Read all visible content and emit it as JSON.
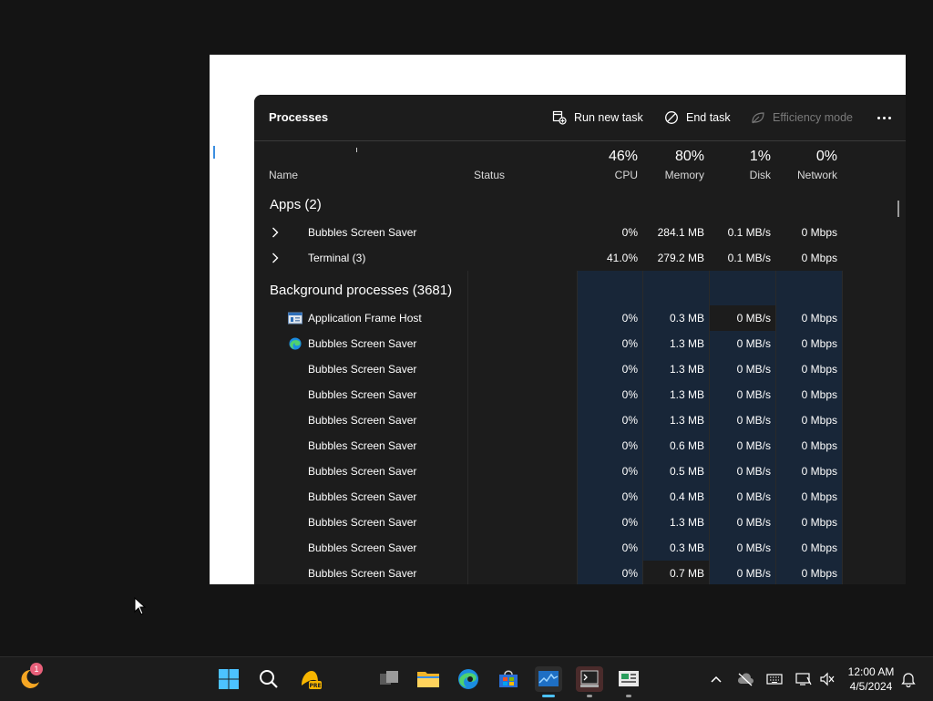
{
  "header": {
    "title": "Processes",
    "run_new_task": "Run new task",
    "end_task": "End task",
    "efficiency_mode": "Efficiency mode"
  },
  "columns": {
    "name": "Name",
    "status": "Status",
    "cpu": {
      "pct": "46%",
      "label": "CPU"
    },
    "memory": {
      "pct": "80%",
      "label": "Memory"
    },
    "disk": {
      "pct": "1%",
      "label": "Disk"
    },
    "network": {
      "pct": "0%",
      "label": "Network"
    }
  },
  "groups": {
    "apps": "Apps (2)",
    "background": "Background processes (3681)"
  },
  "apps": [
    {
      "name": "Bubbles Screen Saver",
      "cpu": "0%",
      "mem": "284.1 MB",
      "disk": "0.1 MB/s",
      "net": "0 Mbps"
    },
    {
      "name": "Terminal (3)",
      "cpu": "41.0%",
      "mem": "279.2 MB",
      "disk": "0.1 MB/s",
      "net": "0 Mbps"
    }
  ],
  "background": [
    {
      "name": "Application Frame Host",
      "icon": "app-frame-icon",
      "cpu": "0%",
      "mem": "0.3 MB",
      "disk": "0 MB/s",
      "net": "0 Mbps"
    },
    {
      "name": "Bubbles Screen Saver",
      "icon": "edge-icon",
      "cpu": "0%",
      "mem": "1.3 MB",
      "disk": "0 MB/s",
      "net": "0 Mbps"
    },
    {
      "name": "Bubbles Screen Saver",
      "cpu": "0%",
      "mem": "1.3 MB",
      "disk": "0 MB/s",
      "net": "0 Mbps"
    },
    {
      "name": "Bubbles Screen Saver",
      "cpu": "0%",
      "mem": "1.3 MB",
      "disk": "0 MB/s",
      "net": "0 Mbps"
    },
    {
      "name": "Bubbles Screen Saver",
      "cpu": "0%",
      "mem": "1.3 MB",
      "disk": "0 MB/s",
      "net": "0 Mbps"
    },
    {
      "name": "Bubbles Screen Saver",
      "cpu": "0%",
      "mem": "0.6 MB",
      "disk": "0 MB/s",
      "net": "0 Mbps"
    },
    {
      "name": "Bubbles Screen Saver",
      "cpu": "0%",
      "mem": "0.5 MB",
      "disk": "0 MB/s",
      "net": "0 Mbps"
    },
    {
      "name": "Bubbles Screen Saver",
      "cpu": "0%",
      "mem": "0.4 MB",
      "disk": "0 MB/s",
      "net": "0 Mbps"
    },
    {
      "name": "Bubbles Screen Saver",
      "cpu": "0%",
      "mem": "1.3 MB",
      "disk": "0 MB/s",
      "net": "0 Mbps"
    },
    {
      "name": "Bubbles Screen Saver",
      "cpu": "0%",
      "mem": "0.3 MB",
      "disk": "0 MB/s",
      "net": "0 Mbps"
    },
    {
      "name": "Bubbles Screen Saver",
      "cpu": "0%",
      "mem": "0.7 MB",
      "disk": "0 MB/s",
      "net": "0 Mbps"
    }
  ],
  "taskbar": {
    "badge_count": "1",
    "time": "12:00 AM",
    "date": "4/5/2024"
  },
  "colors": {
    "heat_blue": "#182638",
    "accent": "#4cc2ff"
  }
}
